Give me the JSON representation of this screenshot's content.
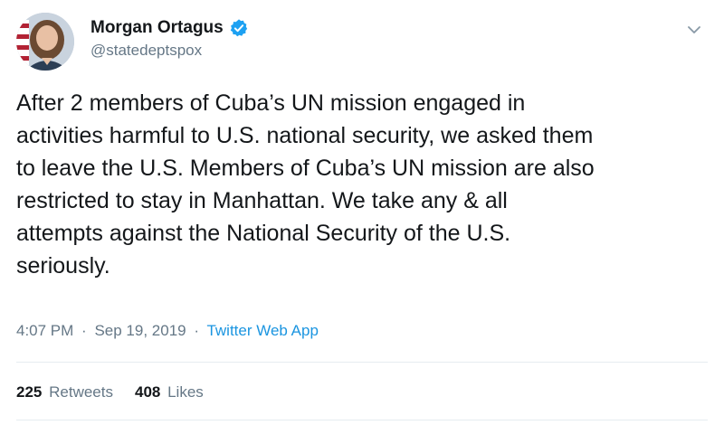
{
  "user": {
    "display_name": "Morgan Ortagus",
    "handle": "@statedeptspox",
    "verified": true
  },
  "tweet": {
    "lines": [
      "After 2 members of Cuba’s UN mission engaged in",
      "activities harmful to U.S. national security, we asked them",
      "to leave the U.S. Members of Cuba’s UN mission are also",
      "restricted to stay in Manhattan. We take any & all",
      "attempts against the National Security of the U.S.",
      "seriously."
    ],
    "time": "4:07 PM",
    "date": "Sep 19, 2019",
    "separator": "·",
    "source": "Twitter Web App"
  },
  "stats": {
    "retweets_count": "225",
    "retweets_label": "Retweets",
    "likes_count": "408",
    "likes_label": "Likes"
  },
  "colors": {
    "text": "#14171a",
    "secondary": "#657786",
    "accent": "#1b95e0",
    "verified": "#1da1f2"
  },
  "icons": {
    "verified": "verified-badge-icon",
    "menu": "chevron-down-icon"
  }
}
